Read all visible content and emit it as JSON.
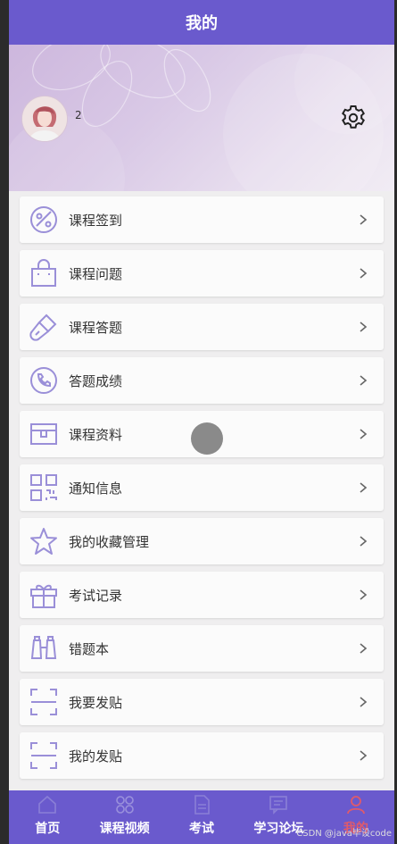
{
  "header": {
    "title": "我的"
  },
  "profile": {
    "username": "2"
  },
  "menu": {
    "items": [
      {
        "label": "课程签到",
        "icon": "palette-icon"
      },
      {
        "label": "课程问题",
        "icon": "bag-icon"
      },
      {
        "label": "课程答题",
        "icon": "brush-icon"
      },
      {
        "label": "答题成绩",
        "icon": "phone-icon"
      },
      {
        "label": "课程资料",
        "icon": "box-icon"
      },
      {
        "label": "通知信息",
        "icon": "qr-icon"
      },
      {
        "label": "我的收藏管理",
        "icon": "star-icon"
      },
      {
        "label": "考试记录",
        "icon": "gift-icon"
      },
      {
        "label": "错题本",
        "icon": "binoculars-icon"
      },
      {
        "label": "我要发贴",
        "icon": "scan-icon"
      },
      {
        "label": "我的发贴",
        "icon": "scan-icon"
      }
    ]
  },
  "tabbar": {
    "items": [
      {
        "label": "首页",
        "icon": "home-icon"
      },
      {
        "label": "课程视频",
        "icon": "grid-icon"
      },
      {
        "label": "考试",
        "icon": "document-icon"
      },
      {
        "label": "学习论坛",
        "icon": "forum-icon"
      },
      {
        "label": "我的",
        "icon": "user-icon",
        "active": true
      }
    ]
  },
  "watermark": "CSDN @java毕设code",
  "colors": {
    "primary": "#6a5acd",
    "icon_stroke": "#9a8fd8",
    "active": "#e05a6a"
  }
}
